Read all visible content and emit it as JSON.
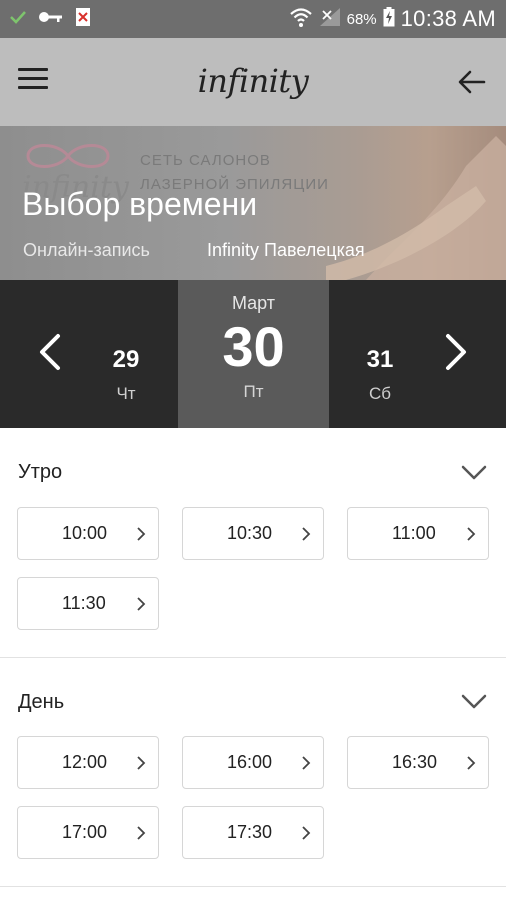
{
  "status_bar": {
    "time": "10:38 AM",
    "battery": "68%"
  },
  "app_bar": {
    "logo": "infinity"
  },
  "banner": {
    "brand_line1": "СЕТЬ САЛОНОВ",
    "brand_line2": "ЛАЗЕРНОЙ ЭПИЛЯЦИИ",
    "brand_logo_text": "infinity",
    "title": "Выбор времени",
    "subtitle_left": "Онлайн-запись",
    "subtitle_right": "Infinity Павелецкая"
  },
  "dates": {
    "prev_day": {
      "num": "29",
      "dow": "Чт"
    },
    "selected": {
      "month": "Март",
      "num": "30",
      "dow": "Пт"
    },
    "next_day": {
      "num": "31",
      "dow": "Сб"
    }
  },
  "morning": {
    "title": "Утро",
    "slots": [
      "10:00",
      "10:30",
      "11:00",
      "11:30"
    ]
  },
  "day": {
    "title": "День",
    "slots": [
      "12:00",
      "16:00",
      "16:30",
      "17:00",
      "17:30"
    ]
  },
  "colors": {
    "appbar": "#bdbdbd",
    "date_strip": "#2a2a2a",
    "date_selected": "#5a5a5a",
    "status_bar": "#6e6e6e"
  }
}
